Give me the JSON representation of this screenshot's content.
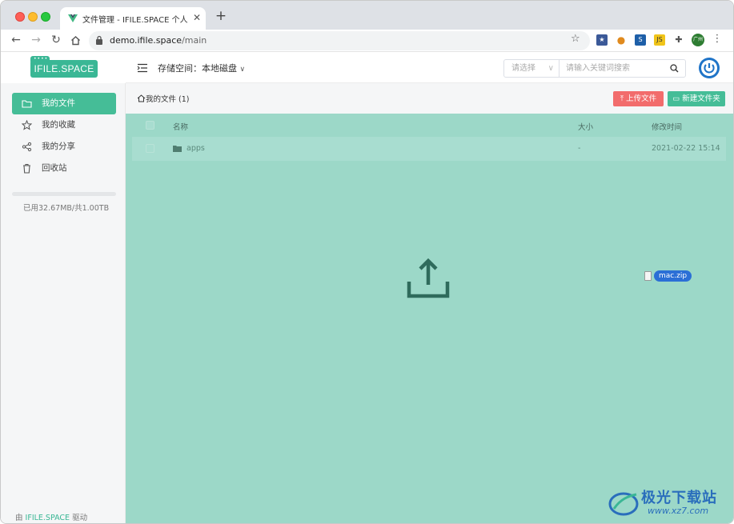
{
  "browser": {
    "tab_title": "文件管理 - IFILE.SPACE 个人云",
    "new_tab": "+",
    "close_tab": "✕",
    "url_host": "demo.ifile.space",
    "url_path": "/main",
    "profile_label": "广州"
  },
  "app": {
    "logo": "IFILE.SPACE",
    "sidebar": {
      "items": [
        {
          "label": "我的文件",
          "icon": "folder-icon",
          "active": true
        },
        {
          "label": "我的收藏",
          "icon": "star-icon",
          "active": false
        },
        {
          "label": "我的分享",
          "icon": "share-icon",
          "active": false
        },
        {
          "label": "回收站",
          "icon": "trash-icon",
          "active": false
        }
      ],
      "storage_usage": "已用32.67MB/共1.00TB",
      "footer_prefix": "由",
      "footer_brand": "IFILE.SPACE",
      "footer_suffix": "驱动"
    },
    "topbar": {
      "storage_label": "存储空间：",
      "storage_value": "本地磁盘",
      "select_placeholder": "请选择",
      "search_placeholder": "请输入关键词搜索"
    },
    "content": {
      "breadcrumb": "我的文件 (1)",
      "upload_button": "上传文件",
      "new_folder_button": "新建文件夹",
      "columns": {
        "name": "名称",
        "size": "大小",
        "time": "修改时间"
      },
      "rows": [
        {
          "name": "apps",
          "size": "-",
          "time": "2021-02-22 15:14"
        }
      ],
      "dragging_file": "mac.zip"
    }
  },
  "watermark": {
    "text": "极光下载站",
    "url": "www.xz7.com"
  },
  "colors": {
    "accent": "#45bd97",
    "danger": "#f26c6c",
    "drop_overlay": "#9cd8c8",
    "power_button": "#1f74c8"
  }
}
